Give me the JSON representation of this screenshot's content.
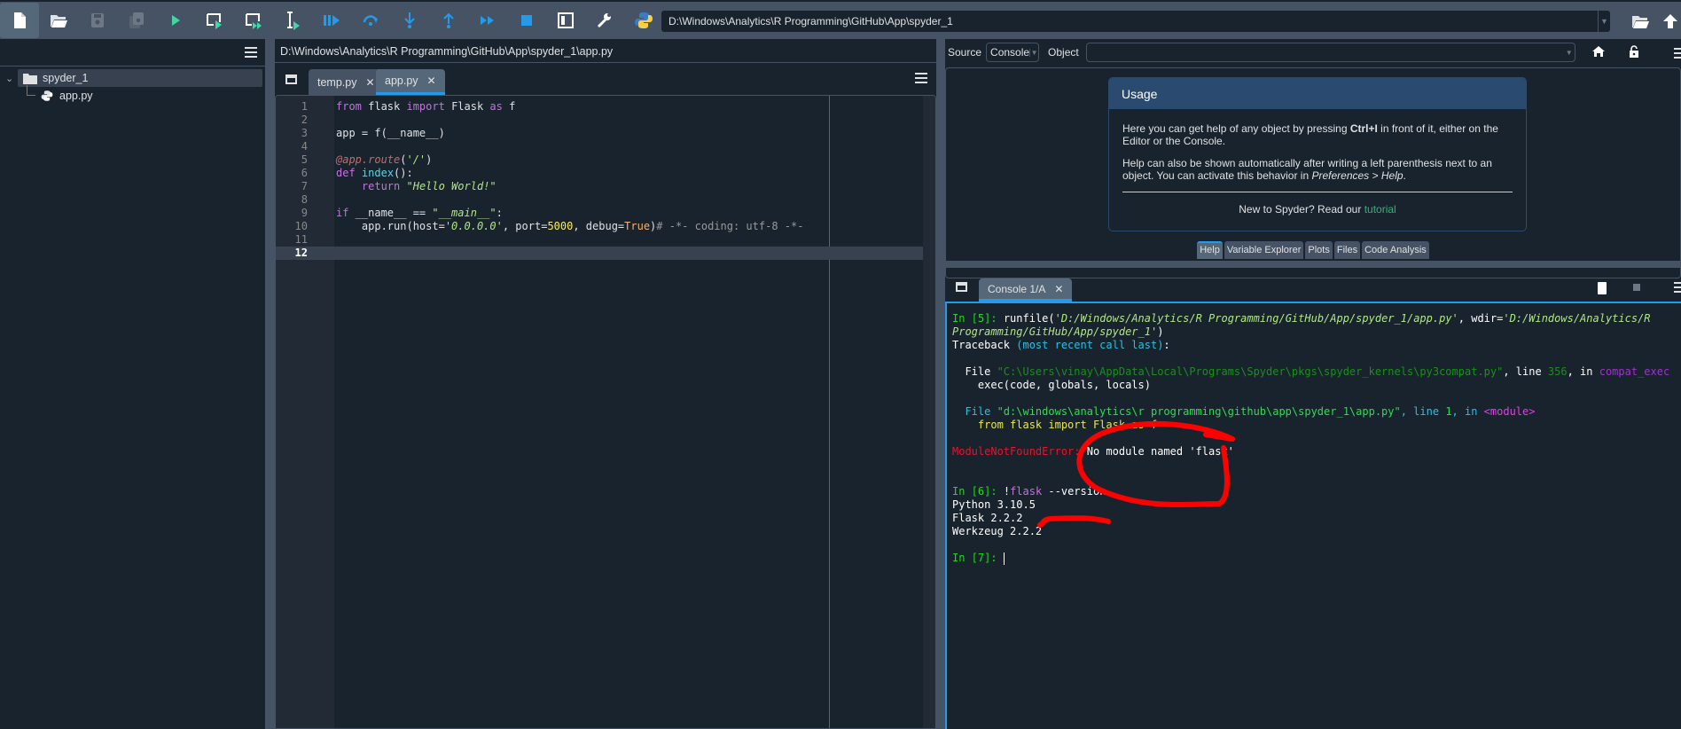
{
  "toolbar": {
    "buttons": [
      {
        "name": "new-file",
        "icon": "new-file-icon"
      },
      {
        "name": "open-file",
        "icon": "folder-open-icon"
      },
      {
        "name": "save-file",
        "icon": "save-icon"
      },
      {
        "name": "save-all",
        "icon": "save-all-icon"
      },
      {
        "name": "run-file",
        "icon": "run-icon"
      },
      {
        "name": "run-cell",
        "icon": "run-cell-icon"
      },
      {
        "name": "run-cell-advance",
        "icon": "run-cell-advance-icon"
      },
      {
        "name": "run-selection",
        "icon": "run-selection-icon"
      },
      {
        "name": "debug-file",
        "icon": "debug-icon"
      },
      {
        "name": "step-over",
        "icon": "step-over-icon"
      },
      {
        "name": "step-into",
        "icon": "step-into-icon"
      },
      {
        "name": "step-return",
        "icon": "step-return-icon"
      },
      {
        "name": "continue",
        "icon": "continue-icon"
      },
      {
        "name": "stop-debug",
        "icon": "stop-icon"
      },
      {
        "name": "maximize-pane",
        "icon": "maximize-pane-icon"
      },
      {
        "name": "preferences",
        "icon": "wrench-icon"
      },
      {
        "name": "python-path",
        "icon": "python-icon"
      }
    ],
    "working_directory": "D:\\Windows\\Analytics\\R Programming\\GitHub\\App\\spyder_1"
  },
  "files": {
    "tree": [
      {
        "label": "spyder_1",
        "type": "folder",
        "expanded": true
      },
      {
        "label": "app.py",
        "type": "python-file"
      }
    ]
  },
  "editor": {
    "path": "D:\\Windows\\Analytics\\R Programming\\GitHub\\App\\spyder_1\\app.py",
    "tabs": [
      {
        "label": "temp.py",
        "active": false
      },
      {
        "label": "app.py",
        "active": true
      }
    ],
    "current_line": 12,
    "lines": [
      {
        "n": "1",
        "tokens": [
          [
            "kw",
            "from"
          ],
          [
            "pl",
            " flask "
          ],
          [
            "kw",
            "import"
          ],
          [
            "pl",
            " Flask "
          ],
          [
            "kw",
            "as"
          ],
          [
            "pl",
            " f"
          ]
        ]
      },
      {
        "n": "2",
        "tokens": []
      },
      {
        "n": "3",
        "tokens": [
          [
            "pl",
            "app = f(__name__)"
          ]
        ]
      },
      {
        "n": "4",
        "tokens": []
      },
      {
        "n": "5",
        "tokens": [
          [
            "dec",
            "@app.route"
          ],
          [
            "pl",
            "("
          ],
          [
            "st",
            "'/'"
          ],
          [
            "pl",
            ")"
          ]
        ]
      },
      {
        "n": "6",
        "tokens": [
          [
            "kw",
            "def"
          ],
          [
            "pl",
            " "
          ],
          [
            "df",
            "index"
          ],
          [
            "pl",
            "():"
          ]
        ]
      },
      {
        "n": "7",
        "tokens": [
          [
            "pl",
            "    "
          ],
          [
            "kw",
            "return"
          ],
          [
            "pl",
            " "
          ],
          [
            "st",
            "\"Hello World!\""
          ]
        ]
      },
      {
        "n": "8",
        "tokens": []
      },
      {
        "n": "9",
        "tokens": [
          [
            "kw",
            "if"
          ],
          [
            "pl",
            " __name__ == "
          ],
          [
            "st",
            "\"__main__\""
          ],
          [
            "pl",
            ":"
          ]
        ]
      },
      {
        "n": "10",
        "tokens": [
          [
            "pl",
            "    app.run(host="
          ],
          [
            "st",
            "'0.0.0.0'"
          ],
          [
            "pl",
            ", port="
          ],
          [
            "nm",
            "5000"
          ],
          [
            "pl",
            ", debug="
          ],
          [
            "bt",
            "True"
          ],
          [
            "pl",
            ")"
          ],
          [
            "cm",
            "# -*- coding: utf-8 -*-"
          ]
        ]
      },
      {
        "n": "11",
        "tokens": []
      },
      {
        "n": "12",
        "tokens": []
      }
    ]
  },
  "help": {
    "source_label": "Source",
    "source_value": "Console",
    "object_label": "Object",
    "object_value": "",
    "usage_title": "Usage",
    "usage_p1_a": "Here you can get help of any object by pressing ",
    "usage_p1_key": "Ctrl+I",
    "usage_p1_b": " in front of it, either on the Editor or the Console.",
    "usage_p2_a": "Help can also be shown automatically after writing a left parenthesis next to an object. You can activate this behavior in ",
    "usage_p2_em": "Preferences > Help",
    "usage_p2_b": ".",
    "footer_text": "New to Spyder? Read our ",
    "footer_link": "tutorial",
    "pane_tabs": [
      {
        "label": "Help",
        "active": true
      },
      {
        "label": "Variable Explorer",
        "active": false
      },
      {
        "label": "Plots",
        "active": false
      },
      {
        "label": "Files",
        "active": false
      },
      {
        "label": "Code Analysis",
        "active": false
      }
    ]
  },
  "console": {
    "tab_label": "Console 1/A",
    "lines": [
      [
        [
          "prompt",
          "In ["
        ],
        [
          "prompt-num",
          "5"
        ],
        [
          "prompt",
          "]: "
        ],
        [
          "c-white",
          "runfile("
        ],
        [
          "c-str",
          "'D:/Windows/Analytics/R Programming/GitHub/App/spyder_1/app.py'"
        ],
        [
          "c-white",
          ", wdir="
        ],
        [
          "c-str",
          "'D:/Windows/Analytics/R"
        ]
      ],
      [
        [
          "c-str",
          "Programming/GitHub/App/spyder_1'"
        ],
        [
          "c-white",
          ")"
        ]
      ],
      [
        [
          "c-white",
          "Traceback "
        ],
        [
          "c-cyan",
          "(most recent call last)"
        ],
        [
          "c-white",
          ":"
        ]
      ],
      [],
      [
        [
          "c-white",
          "  File "
        ],
        [
          "c-dgreen",
          "\"C:\\Users\\vinay\\AppData\\Local\\Programs\\Spyder\\pkgs\\spyder_kernels\\py3compat.py\""
        ],
        [
          "c-white",
          ", line "
        ],
        [
          "c-dgreen",
          "356"
        ],
        [
          "c-white",
          ", in "
        ],
        [
          "c-purple",
          "compat_exec"
        ]
      ],
      [
        [
          "c-white",
          "    exec(code, globals, locals)"
        ]
      ],
      [],
      [
        [
          "c-cyan",
          "  File "
        ],
        [
          "c-green",
          "\"d:\\windows\\analytics\\r programming\\github\\app\\spyder_1\\app.py\""
        ],
        [
          "c-cyan",
          ", line "
        ],
        [
          "c-green",
          "1"
        ],
        [
          "c-cyan",
          ", in "
        ],
        [
          "c-magenta",
          "<module>"
        ]
      ],
      [
        [
          "c-yellow",
          "    from flask import Flask as f"
        ]
      ],
      [],
      [
        [
          "c-red",
          "ModuleNotFoundError:"
        ],
        [
          "c-white",
          " No module named 'flask'"
        ]
      ],
      [],
      [],
      [
        [
          "prompt",
          "In ["
        ],
        [
          "prompt-num",
          "6"
        ],
        [
          "prompt",
          "]: "
        ],
        [
          "c-white",
          "!"
        ],
        [
          "c-flask",
          "flask"
        ],
        [
          "c-white",
          " --version"
        ]
      ],
      [
        [
          "c-white",
          "Python 3.10.5"
        ]
      ],
      [
        [
          "c-white",
          "Flask 2.2.2"
        ]
      ],
      [
        [
          "c-white",
          "Werkzeug 2.2.2"
        ]
      ],
      [],
      [
        [
          "prompt",
          "In ["
        ],
        [
          "prompt-num",
          "7"
        ],
        [
          "prompt",
          "]: "
        ]
      ]
    ]
  },
  "annotation": {
    "color": "#ff0000"
  }
}
